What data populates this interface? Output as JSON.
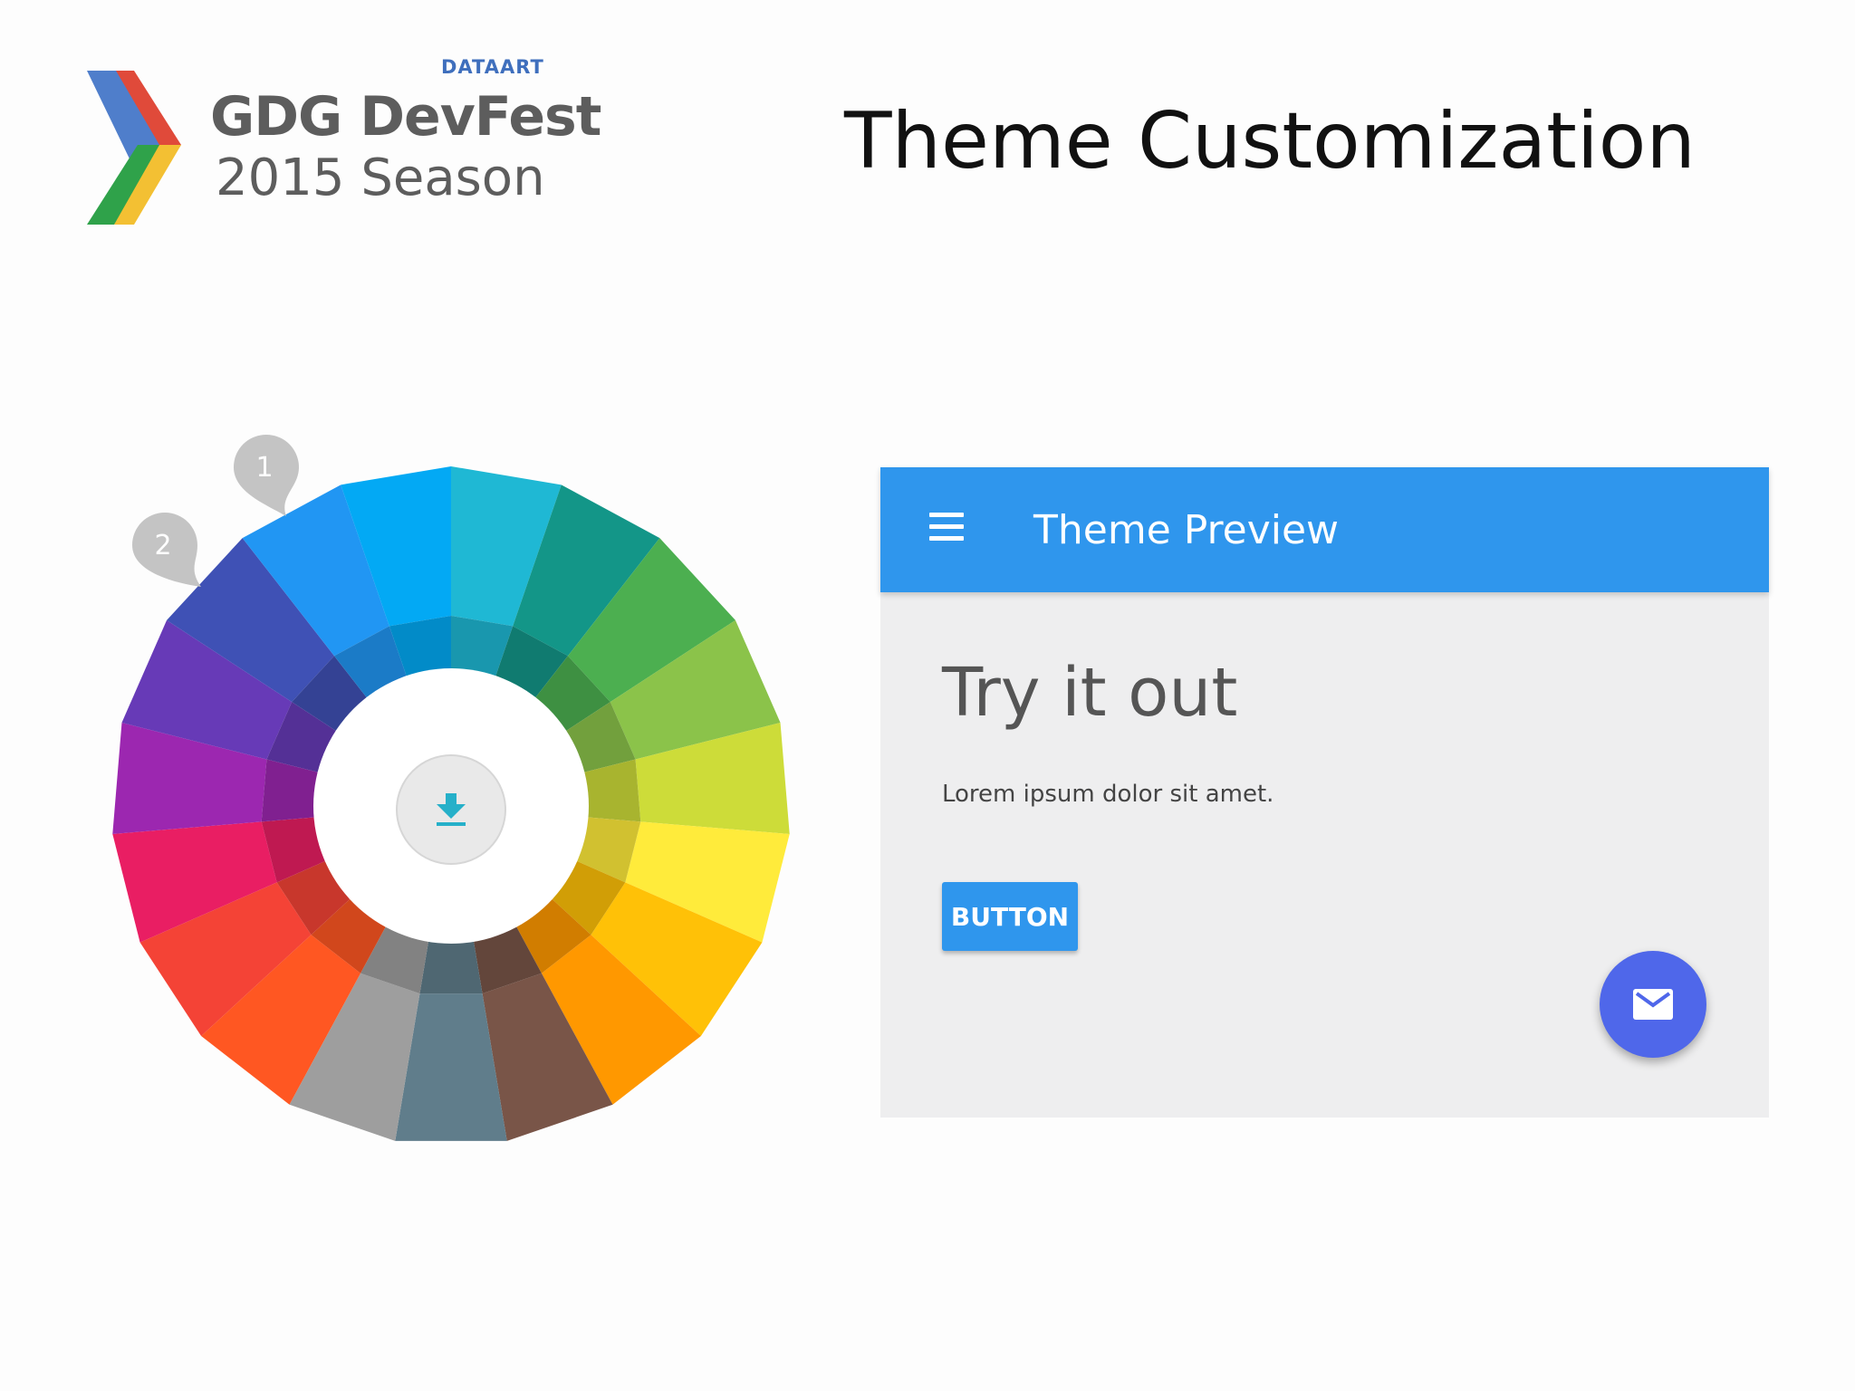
{
  "logo": {
    "sponsor": "DATAART",
    "title": "GDG DevFest",
    "subtitle": "2015 Season",
    "colors": [
      "#e04a3a",
      "#4f7ecb",
      "#2fa24a",
      "#f3c033"
    ]
  },
  "slide": {
    "title": "Theme Customization"
  },
  "color_wheel": {
    "pins": [
      "1",
      "2"
    ],
    "center_icon": "download-icon",
    "pin_color": "#c4c4c4",
    "accent": "#26b0c9"
  },
  "preview": {
    "app_bar": {
      "title": "Theme Preview",
      "menu_icon": "menu-icon",
      "color": "#2f96ed"
    },
    "heading": "Try it out",
    "body": "Lorem ipsum dolor sit amet.",
    "button_label": "BUTTON",
    "fab_icon": "mail-icon",
    "fab_color": "#4f67ea"
  }
}
